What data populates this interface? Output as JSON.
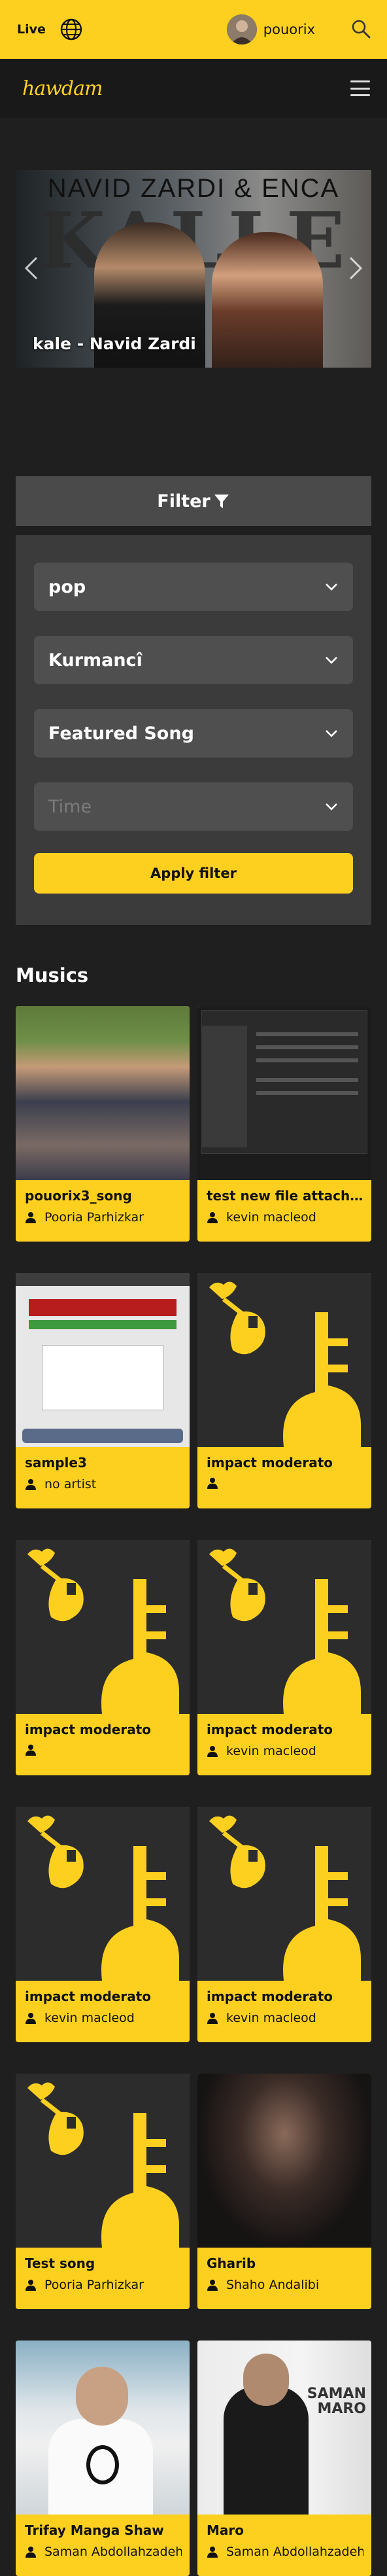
{
  "topbar": {
    "live_label": "Live",
    "username": "pouorix"
  },
  "navbar": {
    "logo": "hawdam"
  },
  "slider": {
    "artist_text": "NAVID ZARDI & ENCA",
    "title_text": "KALLE",
    "caption_song": "kale",
    "caption_sep": " - ",
    "caption_artist": "Navid Zardi"
  },
  "filter": {
    "header": "Filter",
    "genre": "pop",
    "language": "Kurmancî",
    "category": "Featured Song",
    "time_placeholder": "Time",
    "apply_label": "Apply filter"
  },
  "musics": {
    "title": "Musics",
    "items": [
      {
        "title": "pouorix3_song",
        "artist": "Pooria Parhizkar",
        "thumb": "photo1"
      },
      {
        "title": "test new file attach...",
        "artist": "kevin macleod",
        "thumb": "screen"
      },
      {
        "title": "sample3",
        "artist": "no artist",
        "thumb": "web"
      },
      {
        "title": "impact moderato",
        "artist": "",
        "thumb": "logo"
      },
      {
        "title": "impact moderato",
        "artist": "",
        "thumb": "logo"
      },
      {
        "title": "impact moderato",
        "artist": "kevin macleod",
        "thumb": "logo"
      },
      {
        "title": "impact moderato",
        "artist": "kevin macleod",
        "thumb": "logo"
      },
      {
        "title": "impact moderato",
        "artist": "kevin macleod",
        "thumb": "logo"
      },
      {
        "title": "Test song",
        "artist": "Pooria Parhizkar",
        "thumb": "logo"
      },
      {
        "title": "Gharib",
        "artist": "Shaho Andalibi",
        "thumb": "photo2"
      },
      {
        "title": "Trifay Manga Shaw",
        "artist": "Saman Abdollahzadeh",
        "thumb": "photo3"
      },
      {
        "title": "Maro",
        "artist": "Saman Abdollahzadeh",
        "thumb": "photo4"
      }
    ]
  },
  "colors": {
    "accent": "#fdd020",
    "background": "#1f1f1f",
    "panel": "#3b3b3b"
  }
}
